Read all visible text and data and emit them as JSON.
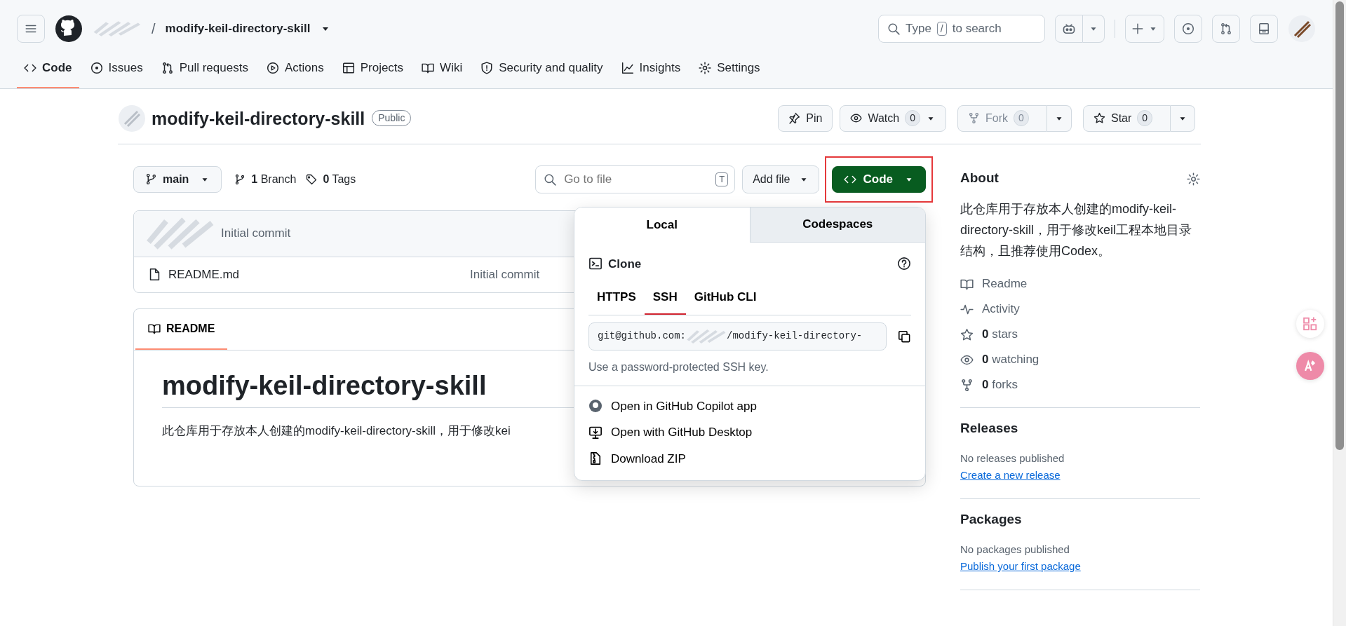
{
  "header": {
    "separator": "/",
    "repo_name": "modify-keil-directory-skill",
    "search": {
      "before": "Type",
      "key": "/",
      "after": "to search"
    }
  },
  "nav_tabs": [
    {
      "label": "Code",
      "selected": true
    },
    {
      "label": "Issues",
      "selected": false
    },
    {
      "label": "Pull requests",
      "selected": false
    },
    {
      "label": "Actions",
      "selected": false
    },
    {
      "label": "Projects",
      "selected": false
    },
    {
      "label": "Wiki",
      "selected": false
    },
    {
      "label": "Security and quality",
      "selected": false
    },
    {
      "label": "Insights",
      "selected": false
    },
    {
      "label": "Settings",
      "selected": false
    }
  ],
  "repo": {
    "title": "modify-keil-directory-skill",
    "visibility": "Public",
    "actions": [
      {
        "label": "Pin",
        "disabled": false
      },
      {
        "label": "Watch",
        "count": "0",
        "disabled": false
      },
      {
        "label": "Fork",
        "count": "0",
        "disabled": true
      },
      {
        "label": "Star",
        "count": "0",
        "disabled": false
      }
    ]
  },
  "toolbar": {
    "branch": "main",
    "branches_count": "1",
    "branches_label": "Branch",
    "tags_count": "0",
    "tags_label": "Tags",
    "goto_placeholder": "Go to file",
    "goto_key": "T",
    "add_file": "Add file",
    "code_button": "Code",
    "code_highlighted": true
  },
  "commit": {
    "message": "Initial commit"
  },
  "files": [
    {
      "name": "README.md",
      "commit": "Initial commit"
    }
  ],
  "readme": {
    "tab": "README",
    "heading": "modify-keil-directory-skill",
    "paragraph": "此仓库用于存放本人创建的modify-keil-directory-skill，用于修改kei"
  },
  "clone_menu": {
    "tabs": [
      {
        "label": "Local",
        "selected": true
      },
      {
        "label": "Codespaces",
        "selected": false
      }
    ],
    "clone_title": "Clone",
    "protocols": [
      {
        "label": "HTTPS",
        "selected": false
      },
      {
        "label": "SSH",
        "selected": true
      },
      {
        "label": "GitHub CLI",
        "selected": false
      }
    ],
    "url_start": "git@github.com:",
    "url_end": "/modify-keil-directory-",
    "hint": "Use a password-protected SSH key.",
    "actions": [
      "Open in GitHub Copilot app",
      "Open with GitHub Desktop",
      "Download ZIP"
    ]
  },
  "about": {
    "title": "About",
    "description": "此仓库用于存放本人创建的modify-keil-directory-skill，用于修改keil工程本地目录结构，且推荐使用Codex。",
    "stats": [
      {
        "label": "Readme"
      },
      {
        "label": "Activity"
      },
      {
        "count": "0",
        "label": "stars"
      },
      {
        "count": "0",
        "label": "watching"
      },
      {
        "count": "0",
        "label": "forks"
      }
    ]
  },
  "releases": {
    "title": "Releases",
    "note": "No releases published",
    "link": "Create a new release"
  },
  "packages": {
    "title": "Packages",
    "note": "No packages published",
    "link": "Publish your first package"
  }
}
